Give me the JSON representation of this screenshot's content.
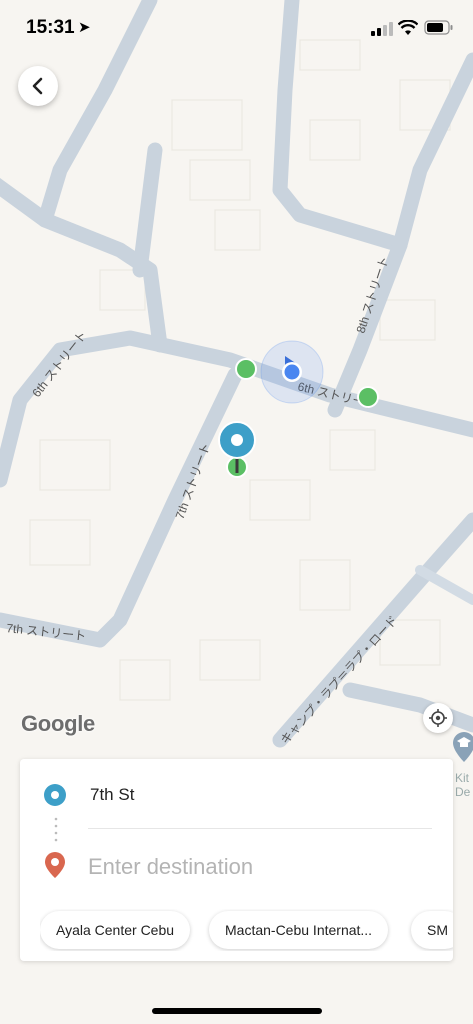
{
  "status_bar": {
    "time": "15:31",
    "location_arrow": "location-arrow-icon",
    "icons": [
      "signal-icon",
      "wifi-icon",
      "battery-icon"
    ]
  },
  "map": {
    "streets": [
      "6th ストリート",
      "6th ストリート",
      "7th ストリート",
      "7th ストリート",
      "8th ストリート",
      "キャンプ・ラプ＝ラプ・ロード"
    ],
    "attribution": "Google",
    "poi_label": "Kit\nDe",
    "colors": {
      "road": "#c8d2dc",
      "background": "#f7f5f1",
      "pickup_pin": "#3d9fc8",
      "green_marker": "#5bbf64",
      "user_dot": "#4a86f0"
    }
  },
  "panel": {
    "origin": "7th St",
    "destination_placeholder": "Enter destination",
    "chips": [
      "Ayala Center Cebu",
      "Mactan-Cebu Internat...",
      "SM"
    ]
  }
}
